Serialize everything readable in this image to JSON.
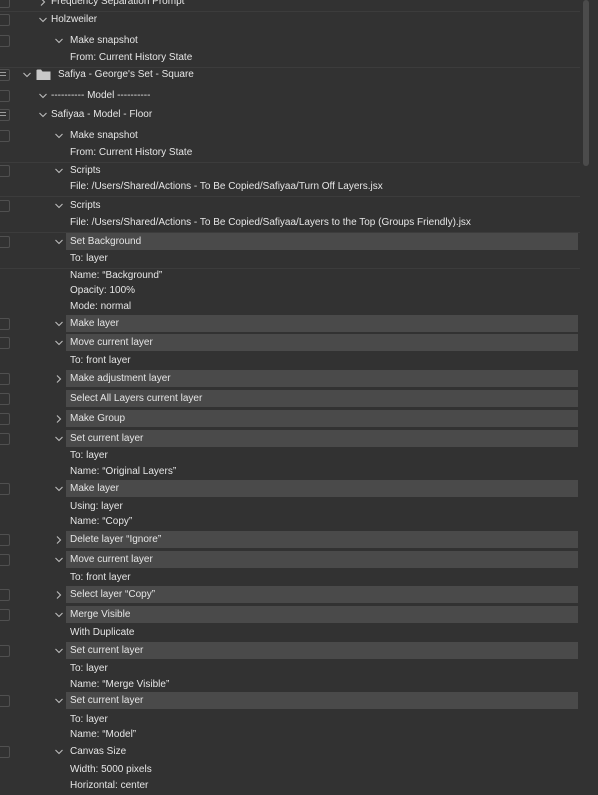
{
  "rows": [
    {
      "kind": "item",
      "level": 2,
      "text": "Frequency Separation Prompt",
      "twisty": "right",
      "check": "empty",
      "sep": true
    },
    {
      "kind": "item",
      "level": 2,
      "text": "Holzweiler",
      "twisty": "down",
      "check": "empty",
      "sep": false
    },
    {
      "kind": "item",
      "level": 3,
      "text": "Make snapshot",
      "twisty": "down",
      "check": "empty",
      "sep": false
    },
    {
      "kind": "detail",
      "level": 3,
      "text": "From: Current History State",
      "sep": true
    },
    {
      "kind": "set",
      "level": 1,
      "text": "Safiya - George's Set - Square",
      "twisty": "down",
      "check": "dialog",
      "folder": true,
      "sep": false
    },
    {
      "kind": "item",
      "level": 2,
      "text": "---------- Model ----------",
      "twisty": "down",
      "check": "empty",
      "sep": false
    },
    {
      "kind": "item",
      "level": 2,
      "text": "Safiyaa - Model - Floor",
      "twisty": "down",
      "check": "dialog",
      "sep": false
    },
    {
      "kind": "item",
      "level": 3,
      "text": "Make snapshot",
      "twisty": "down",
      "check": "empty",
      "sep": false
    },
    {
      "kind": "detail",
      "level": 3,
      "text": "From: Current History State",
      "sep": true
    },
    {
      "kind": "item",
      "level": 3,
      "text": "Scripts",
      "twisty": "down",
      "check": "empty",
      "sep": false
    },
    {
      "kind": "detail",
      "level": 3,
      "text": "File: /Users/Shared/Actions - To Be Copied/Safiyaa/Turn Off Layers.jsx",
      "sep": true
    },
    {
      "kind": "item",
      "level": 3,
      "text": "Scripts",
      "twisty": "down",
      "check": "empty",
      "sep": false
    },
    {
      "kind": "detail",
      "level": 3,
      "text": "File: /Users/Shared/Actions - To Be Copied/Safiyaa/Layers to the Top (Groups Friendly).jsx",
      "sep": true
    },
    {
      "kind": "item",
      "level": 3,
      "text": "Set Background",
      "twisty": "down",
      "check": "empty",
      "highlight": true,
      "sep": false
    },
    {
      "kind": "detail",
      "level": 3,
      "text": "To: layer",
      "sep": true
    },
    {
      "kind": "detail",
      "level": 3,
      "text": "Name:  “Background”",
      "sep": false
    },
    {
      "kind": "detail",
      "level": 3,
      "text": "Opacity: 100%",
      "sep": false
    },
    {
      "kind": "detail",
      "level": 3,
      "text": "Mode: normal",
      "sep": false
    },
    {
      "kind": "item",
      "level": 3,
      "text": "Make layer",
      "twisty": "down",
      "check": "empty",
      "highlight": true,
      "sep": false
    },
    {
      "kind": "item",
      "level": 3,
      "text": "Move current layer",
      "twisty": "down",
      "check": "empty",
      "highlight": true,
      "sep": false
    },
    {
      "kind": "detail",
      "level": 3,
      "text": "To: front layer",
      "sep": false
    },
    {
      "kind": "item",
      "level": 3,
      "text": "Make adjustment layer",
      "twisty": "right",
      "check": "empty",
      "highlight": true,
      "sep": false
    },
    {
      "kind": "item",
      "level": 3,
      "text": "Select All Layers current layer",
      "twisty": "none",
      "check": "empty",
      "highlight": true,
      "sep": false
    },
    {
      "kind": "item",
      "level": 3,
      "text": "Make Group",
      "twisty": "right",
      "check": "empty",
      "highlight": true,
      "sep": false
    },
    {
      "kind": "item",
      "level": 3,
      "text": "Set current layer",
      "twisty": "down",
      "check": "empty",
      "highlight": true,
      "sep": false
    },
    {
      "kind": "detail",
      "level": 3,
      "text": "To: layer",
      "sep": false
    },
    {
      "kind": "detail",
      "level": 3,
      "text": "Name:  “Original Layers”",
      "sep": false
    },
    {
      "kind": "item",
      "level": 3,
      "text": "Make layer",
      "twisty": "down",
      "check": "empty",
      "highlight": true,
      "sep": false
    },
    {
      "kind": "detail",
      "level": 3,
      "text": "Using: layer",
      "sep": false
    },
    {
      "kind": "detail",
      "level": 3,
      "text": "Name:  “Copy”",
      "sep": false
    },
    {
      "kind": "item",
      "level": 3,
      "text": "Delete layer “Ignore”",
      "twisty": "right",
      "check": "empty",
      "highlight": true,
      "sep": false
    },
    {
      "kind": "item",
      "level": 3,
      "text": "Move current layer",
      "twisty": "down",
      "check": "empty",
      "highlight": true,
      "sep": false
    },
    {
      "kind": "detail",
      "level": 3,
      "text": "To: front layer",
      "sep": false
    },
    {
      "kind": "item",
      "level": 3,
      "text": "Select layer “Copy”",
      "twisty": "right",
      "check": "empty",
      "highlight": true,
      "sep": false
    },
    {
      "kind": "item",
      "level": 3,
      "text": "Merge Visible",
      "twisty": "down",
      "check": "empty",
      "highlight": true,
      "sep": false
    },
    {
      "kind": "detail",
      "level": 3,
      "text": "With Duplicate",
      "sep": false
    },
    {
      "kind": "item",
      "level": 3,
      "text": "Set current layer",
      "twisty": "down",
      "check": "empty",
      "highlight": true,
      "sep": false
    },
    {
      "kind": "detail",
      "level": 3,
      "text": "To: layer",
      "sep": false
    },
    {
      "kind": "detail",
      "level": 3,
      "text": "Name:  “Merge Visible”",
      "sep": false
    },
    {
      "kind": "item",
      "level": 3,
      "text": "Set current layer",
      "twisty": "down",
      "check": "empty",
      "highlight": true,
      "sep": false
    },
    {
      "kind": "detail",
      "level": 3,
      "text": "To: layer",
      "sep": false
    },
    {
      "kind": "detail",
      "level": 3,
      "text": "Name:  “Model”",
      "sep": false
    },
    {
      "kind": "item",
      "level": 3,
      "text": "Canvas Size",
      "twisty": "down",
      "check": "empty",
      "sep": false
    },
    {
      "kind": "detail",
      "level": 3,
      "text": "Width: 5000 pixels",
      "sep": false
    },
    {
      "kind": "detail",
      "level": 3,
      "text": "Horizontal: center",
      "sep": false
    }
  ]
}
